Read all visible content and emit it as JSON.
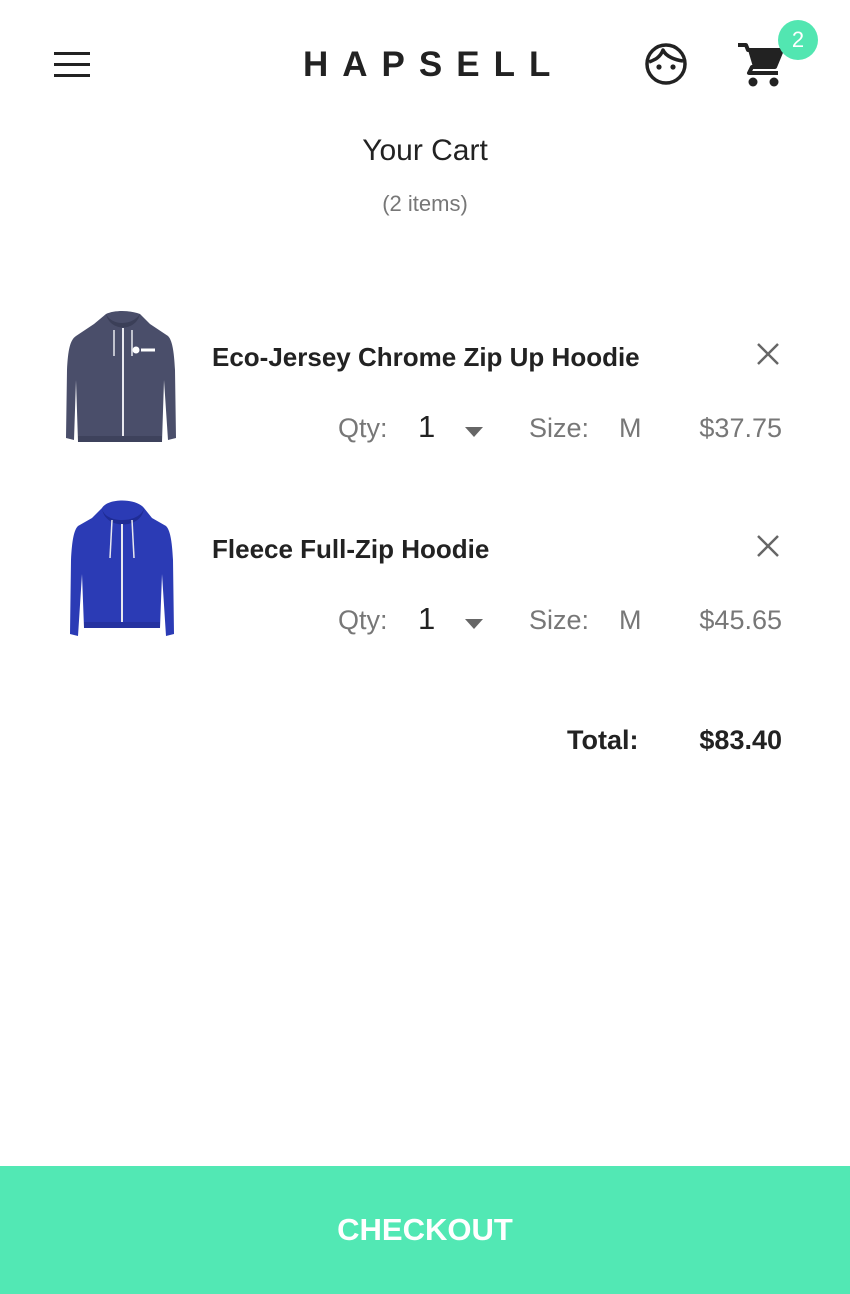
{
  "header": {
    "brand": "HAPSELL",
    "menu_icon": "hamburger-menu-icon",
    "account_icon": "face-account-icon",
    "cart_icon": "shopping-cart-icon",
    "cart_badge_count": "2"
  },
  "cart": {
    "title": "Your Cart",
    "item_count_text": "(2 items)",
    "qty_label": "Qty:",
    "size_label": "Size:",
    "items": [
      {
        "name": "Eco-Jersey Chrome Zip Up Hoodie",
        "qty": "1",
        "size": "M",
        "price": "$37.75",
        "image": "charcoal-zip-hoodie-image"
      },
      {
        "name": "Fleece Full-Zip Hoodie",
        "qty": "1",
        "size": "M",
        "price": "$45.65",
        "image": "royal-blue-zip-hoodie-image"
      }
    ],
    "total_label": "Total:",
    "total_value": "$83.40"
  },
  "checkout": {
    "label": "CHECKOUT"
  },
  "colors": {
    "accent": "#52e8b4",
    "text": "#222222",
    "muted": "#777777",
    "item1_hoodie": "#4a4e6a",
    "item2_hoodie": "#2b3bb5"
  }
}
